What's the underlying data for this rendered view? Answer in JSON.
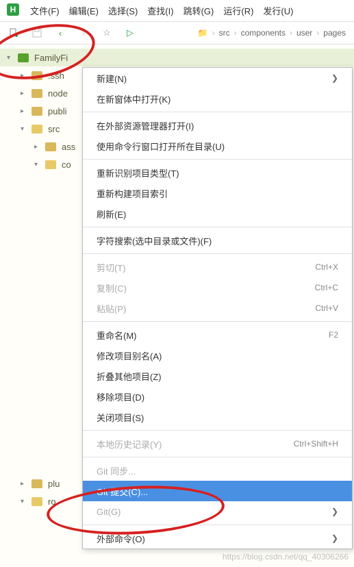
{
  "menubar": {
    "items": [
      "文件(F)",
      "编辑(E)",
      "选择(S)",
      "查找(I)",
      "跳转(G)",
      "运行(R)",
      "发行(U)"
    ]
  },
  "app_icon_letter": "H",
  "breadcrumbs": {
    "items": [
      "src",
      "components",
      "user",
      "pages"
    ]
  },
  "tree": {
    "root": "FamilyFi",
    "nodes": [
      {
        "label": ".ssh",
        "indent": 1,
        "expanded": false
      },
      {
        "label": "node",
        "indent": 1,
        "expanded": false
      },
      {
        "label": "publi",
        "indent": 1,
        "expanded": false
      },
      {
        "label": "src",
        "indent": 1,
        "expanded": true
      },
      {
        "label": "ass",
        "indent": 2,
        "expanded": false
      },
      {
        "label": "co",
        "indent": 2,
        "expanded": true
      },
      {
        "label": "plu",
        "indent": 1,
        "expanded": false
      },
      {
        "label": "ro",
        "indent": 1,
        "expanded": true
      }
    ]
  },
  "context_menu": {
    "groups": [
      [
        {
          "label": "新建(N)",
          "arrow": true
        },
        {
          "label": "在新窗体中打开(K)"
        }
      ],
      [
        {
          "label": "在外部资源管理器打开(I)"
        },
        {
          "label": "使用命令行窗口打开所在目录(U)"
        }
      ],
      [
        {
          "label": "重新识别项目类型(T)"
        },
        {
          "label": "重新构建项目索引"
        },
        {
          "label": "刷新(E)"
        }
      ],
      [
        {
          "label": "字符搜索(选中目录或文件)(F)"
        }
      ],
      [
        {
          "label": "剪切(T)",
          "shortcut": "Ctrl+X",
          "disabled": true
        },
        {
          "label": "复制(C)",
          "shortcut": "Ctrl+C",
          "disabled": true
        },
        {
          "label": "粘贴(P)",
          "shortcut": "Ctrl+V",
          "disabled": true
        }
      ],
      [
        {
          "label": "重命名(M)",
          "shortcut": "F2"
        },
        {
          "label": "修改项目别名(A)"
        },
        {
          "label": "折叠其他项目(Z)"
        },
        {
          "label": "移除项目(D)"
        },
        {
          "label": "关闭项目(S)"
        }
      ],
      [
        {
          "label": "本地历史记录(Y)",
          "shortcut": "Ctrl+Shift+H",
          "disabled": true
        }
      ],
      [
        {
          "label": "Git 同步...",
          "disabled": true
        },
        {
          "label": "Git 提交(C)...",
          "highlighted": true
        },
        {
          "label": "Git(G)",
          "arrow": true,
          "disabled": true
        }
      ],
      [
        {
          "label": "外部命令(O)",
          "arrow": true
        }
      ]
    ]
  },
  "watermark": "https://blog.csdn.net/qq_40306266"
}
